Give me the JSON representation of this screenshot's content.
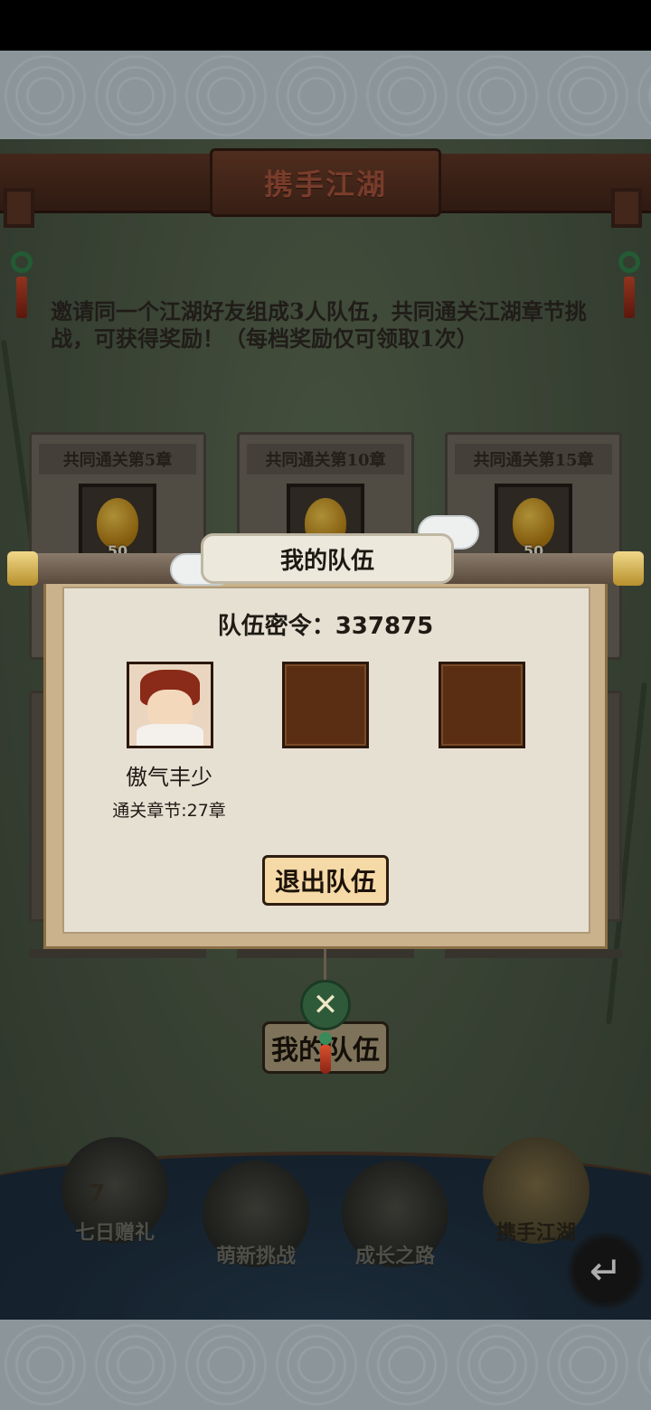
{
  "header": {
    "title": "携手江湖"
  },
  "intro": "邀请同一个江湖好友组成3人队伍，共同通关江湖章节挑战，可获得奖励！（每档奖励仅可领取1次）",
  "rewards": [
    {
      "label": "共同通关第5章",
      "quantity": "50",
      "icon": "gourd-icon"
    },
    {
      "label": "共同通关第10章",
      "quantity": "50",
      "icon": "gourd-icon"
    },
    {
      "label": "共同通关第15章",
      "quantity": "50",
      "icon": "gourd-icon"
    }
  ],
  "main_button": {
    "label": "我的队伍"
  },
  "bottom_nav": [
    {
      "label": "七日赠礼",
      "icon": "chest-icon",
      "badge": "7",
      "active": false
    },
    {
      "label": "萌新挑战",
      "icon": "mask-icon",
      "active": false
    },
    {
      "label": "成长之路",
      "icon": "book-icon",
      "active": false
    },
    {
      "label": "携手江湖",
      "icon": "handshake-icon",
      "active": true
    }
  ],
  "modal": {
    "title": "我的队伍",
    "team_code_label": "队伍密令：",
    "team_code": "337875",
    "team_code_text": "队伍密令：337875",
    "members": [
      {
        "name": "傲气丰少",
        "chapter": "通关章节:27章"
      }
    ],
    "leave_label": "退出队伍",
    "close_icon": "crossed-swords-icon"
  },
  "colors": {
    "scene_bg": "#4a5744",
    "header_wood": "#5a3424",
    "slot_brown": "#5a2e12",
    "close_green": "#2f5a3a",
    "leave_button_bg": "#f5d9a6"
  }
}
